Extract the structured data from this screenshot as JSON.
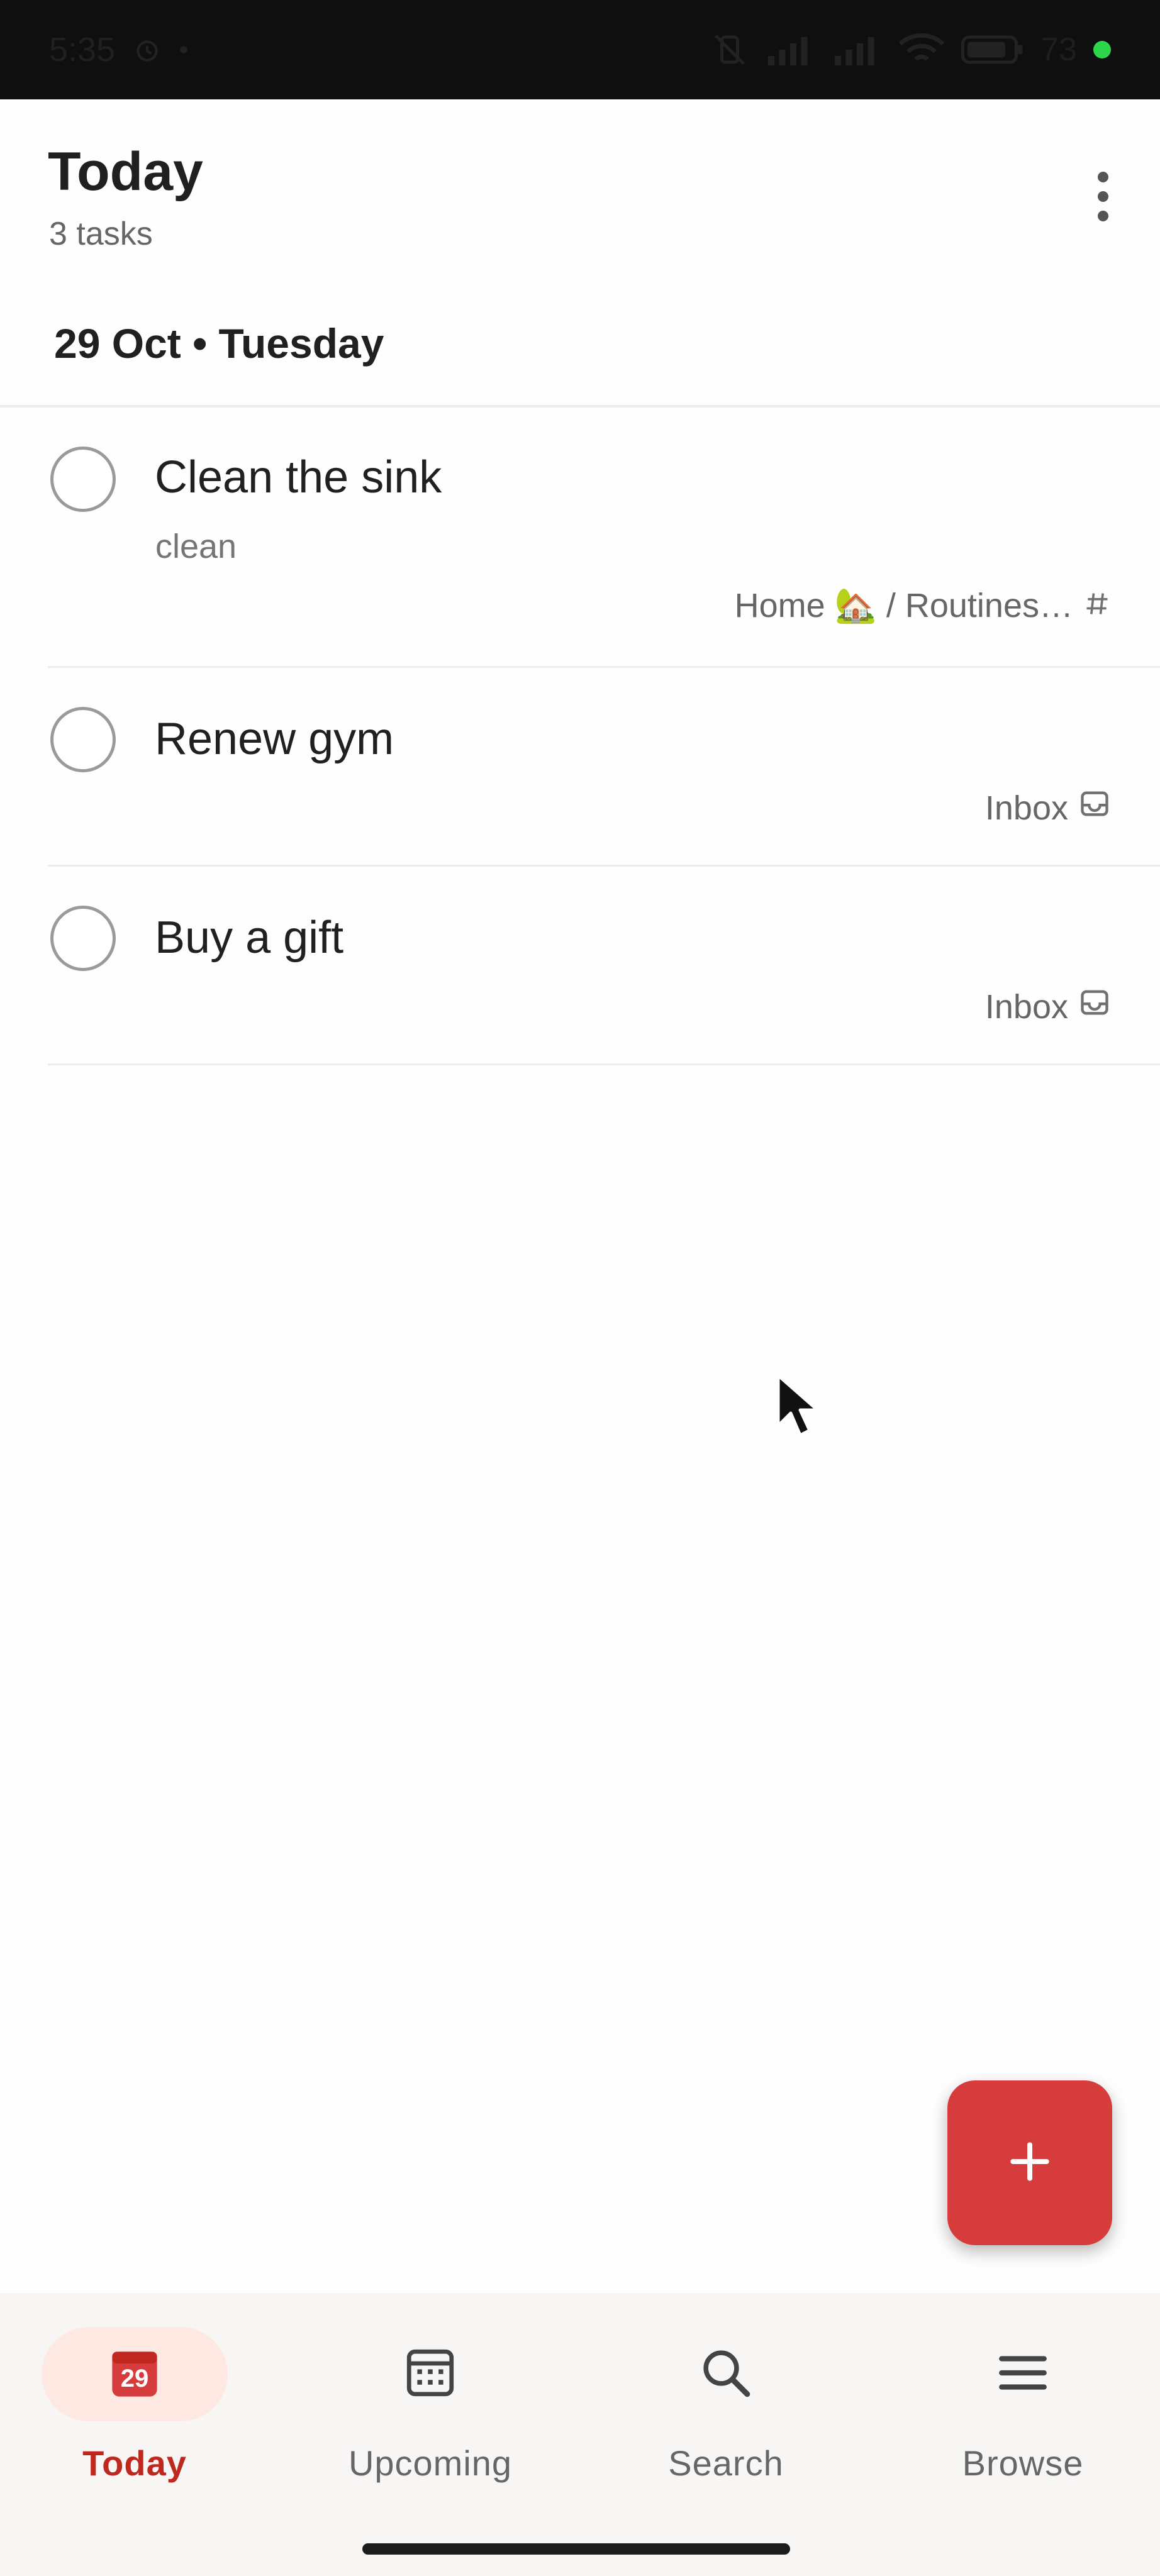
{
  "status_bar": {
    "time": "5:35",
    "battery_percent": "73",
    "icons": [
      "alarm-icon",
      "dot-icon",
      "vibrate-off-icon",
      "signal-icon",
      "signal-icon",
      "wifi-icon",
      "battery-icon"
    ]
  },
  "header": {
    "title": "Today",
    "task_count": "3 tasks",
    "menu_icon": "more-vert-icon"
  },
  "section": {
    "date_heading": "29 Oct • Tuesday"
  },
  "tasks": [
    {
      "title": "Clean the sink",
      "description": "clean",
      "project": "Home 🏡 / Routines…",
      "project_icon": "hash-icon"
    },
    {
      "title": "Renew gym",
      "description": "",
      "project": "Inbox",
      "project_icon": "inbox-icon"
    },
    {
      "title": "Buy a gift",
      "description": "",
      "project": "Inbox",
      "project_icon": "inbox-icon"
    }
  ],
  "fab": {
    "icon": "plus-icon"
  },
  "bottom_nav": {
    "items": [
      {
        "label": "Today",
        "icon": "calendar-today-icon",
        "badge": "29",
        "active": true
      },
      {
        "label": "Upcoming",
        "icon": "calendar-grid-icon",
        "active": false
      },
      {
        "label": "Search",
        "icon": "search-icon",
        "active": false
      },
      {
        "label": "Browse",
        "icon": "menu-icon",
        "active": false
      }
    ]
  },
  "colors": {
    "accent": "#d63c3c",
    "active_nav_text": "#c0281f",
    "active_nav_pill": "#fde9e2"
  }
}
